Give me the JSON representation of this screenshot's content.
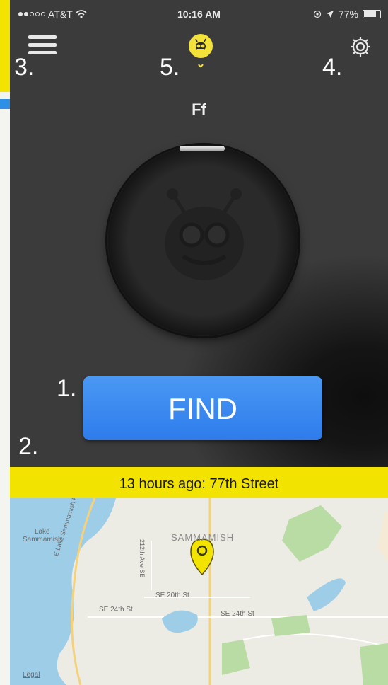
{
  "status_bar": {
    "carrier": "AT&T",
    "time": "10:16 AM",
    "battery_percent": "77%",
    "battery_level": 0.77
  },
  "annotations": {
    "find": "1.",
    "history": "2.",
    "menu": "3.",
    "settings": "4.",
    "device": "5."
  },
  "device": {
    "name": "Ff"
  },
  "find_button": {
    "label": "FIND"
  },
  "last_seen": {
    "text": "13 hours ago: 77th Street"
  },
  "map": {
    "labels": {
      "lake": "Lake\nSammamish",
      "parkway": "E Lake Sammamish Pkwy SE",
      "ave": "212th Ave SE",
      "town": "SAMMAMISH",
      "st20": "SE 20th St",
      "st24_left": "SE 24th St",
      "st24_right": "SE 24th St",
      "legal": "Legal"
    }
  },
  "colors": {
    "accent_yellow": "#f2e400",
    "find_blue": "#3a8af0",
    "dark_bg": "#3b3b3c"
  },
  "icons": {
    "menu": "hamburger-icon",
    "settings": "gear-icon",
    "device": "bee-icon",
    "pin": "map-pin-icon"
  }
}
